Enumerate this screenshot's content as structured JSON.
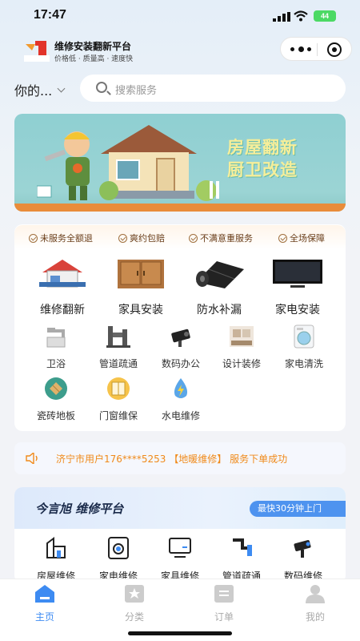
{
  "status": {
    "time": "17:47",
    "battery": "44"
  },
  "header": {
    "logo_text": "今言旭",
    "title": "维修安装翻新平台",
    "slogan": "价格低 · 质量高 · 速度快"
  },
  "location": "你的...",
  "search": {
    "placeholder": "搜索服务"
  },
  "banner": {
    "line1": "房屋翻新",
    "line2": "厨卫改造"
  },
  "guarantees": [
    "未服务全额退",
    "爽约包赔",
    "不满意重服务",
    "全场保障"
  ],
  "big_categories": [
    {
      "label": "维修翻新",
      "icon": "house-repair-icon"
    },
    {
      "label": "家具安装",
      "icon": "cabinet-icon"
    },
    {
      "label": "防水补漏",
      "icon": "waterproof-roll-icon"
    },
    {
      "label": "家电安装",
      "icon": "tv-icon"
    }
  ],
  "small_categories": [
    {
      "label": "卫浴",
      "icon": "faucet-icon"
    },
    {
      "label": "管道疏通",
      "icon": "pipe-icon"
    },
    {
      "label": "数码办公",
      "icon": "camera-icon"
    },
    {
      "label": "设计装修",
      "icon": "room-design-icon"
    },
    {
      "label": "家电清洗",
      "icon": "washer-icon"
    },
    {
      "label": "瓷砖地板",
      "icon": "tile-icon"
    },
    {
      "label": "门窗维保",
      "icon": "window-icon"
    },
    {
      "label": "水电维修",
      "icon": "water-electric-icon"
    }
  ],
  "notice": {
    "text": "济宁市用户176****5253 【地暖维修】 服务下单成功"
  },
  "platform": {
    "title": "今言旭 维修平台",
    "badge": "最快30分钟上门",
    "services": [
      {
        "label": "房屋维修",
        "icon": "house-icon"
      },
      {
        "label": "家电维修",
        "icon": "washer-icon"
      },
      {
        "label": "家具维修",
        "icon": "monitor-icon"
      },
      {
        "label": "管道疏通",
        "icon": "pipe-icon"
      },
      {
        "label": "数码维修",
        "icon": "camera-icon"
      }
    ]
  },
  "tabs": [
    {
      "label": "主页",
      "active": true
    },
    {
      "label": "分类",
      "active": false
    },
    {
      "label": "订单",
      "active": false
    },
    {
      "label": "我的",
      "active": false
    }
  ],
  "colors": {
    "accent": "#3d8bf2",
    "notice": "#f08a1a",
    "banner_text": "#f6ee9a"
  }
}
